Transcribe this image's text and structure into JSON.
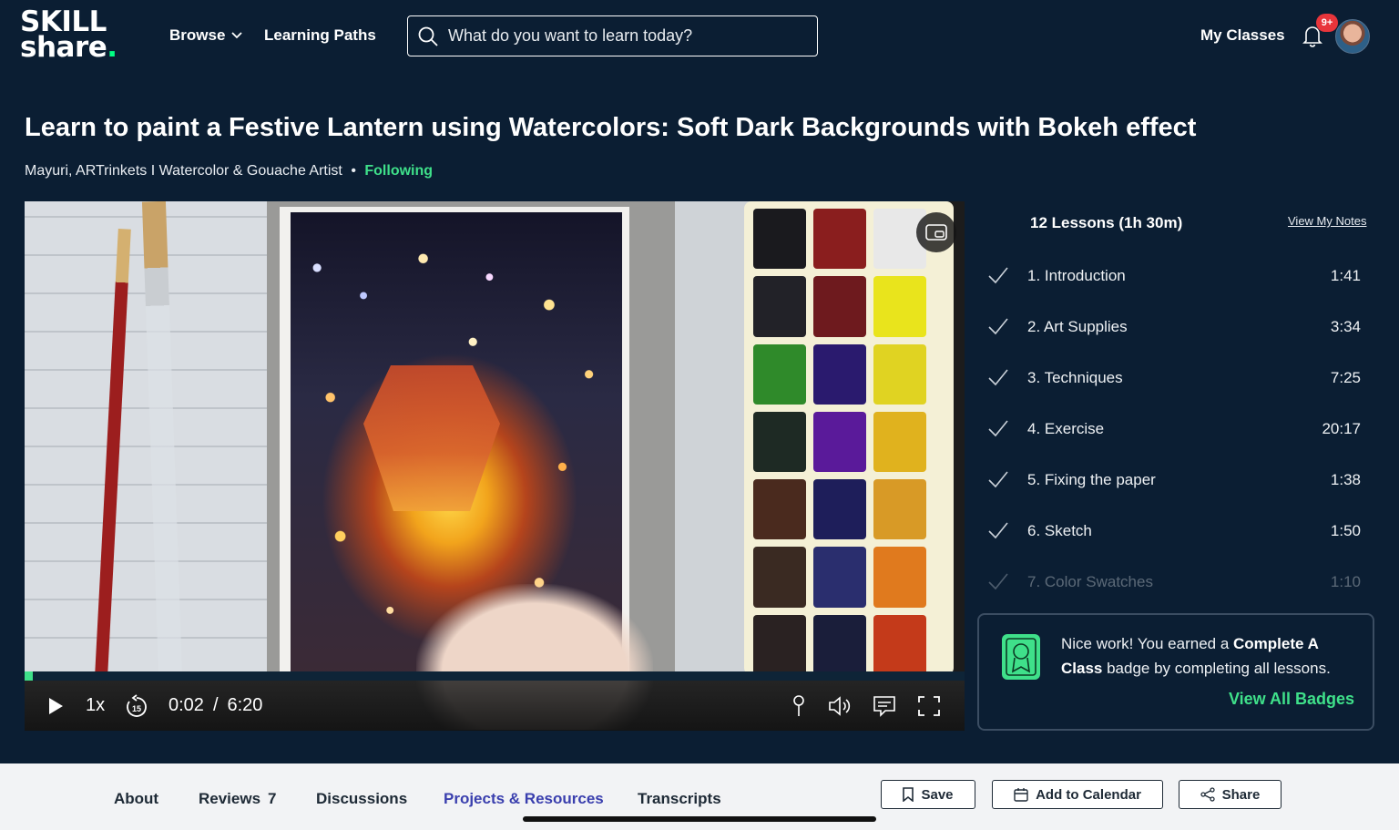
{
  "header": {
    "logo_line1": "SKILL",
    "logo_line2": "share",
    "logo_dot": ".",
    "browse_label": "Browse",
    "learning_paths_label": "Learning Paths",
    "search_placeholder": "What do you want to learn today?",
    "my_classes_label": "My Classes",
    "notification_count": "9+"
  },
  "course": {
    "title": "Learn to paint a Festive Lantern using Watercolors: Soft Dark Backgrounds with Bokeh effect",
    "teacher": "Mayuri, ARTrinkets I Watercolor & Gouache Artist",
    "separator": "•",
    "follow_status": "Following"
  },
  "player": {
    "speed": "1x",
    "skip_seconds": "15",
    "current_time": "0:02",
    "time_separator": "/",
    "total_time": "6:20",
    "progress_fraction": 0.009
  },
  "lessons": {
    "header": "12 Lessons (1h 30m)",
    "view_notes_label": "View My Notes",
    "items": [
      {
        "name": "1. Introduction",
        "duration": "1:41"
      },
      {
        "name": "2. Art Supplies",
        "duration": "3:34"
      },
      {
        "name": "3. Techniques",
        "duration": "7:25"
      },
      {
        "name": "4. Exercise",
        "duration": "20:17"
      },
      {
        "name": "5. Fixing the paper",
        "duration": "1:38"
      },
      {
        "name": "6. Sketch",
        "duration": "1:50"
      },
      {
        "name": "7. Color Swatches",
        "duration": "1:10"
      }
    ]
  },
  "badge": {
    "text_before": "Nice work! You earned a ",
    "badge_name": "Complete A Class",
    "text_after": " badge by completing all lessons.",
    "view_all_label": "View All Badges"
  },
  "tabs": {
    "about": "About",
    "reviews": "Reviews",
    "reviews_count": "7",
    "discussions": "Discussions",
    "projects": "Projects & Resources",
    "transcripts": "Transcripts"
  },
  "actions": {
    "save": "Save",
    "calendar": "Add to Calendar",
    "share": "Share"
  },
  "colors": {
    "background": "#0b1e33",
    "accent_green": "#3fe08a",
    "active_tab": "#3a3fae",
    "notification_red": "#e8353b"
  }
}
